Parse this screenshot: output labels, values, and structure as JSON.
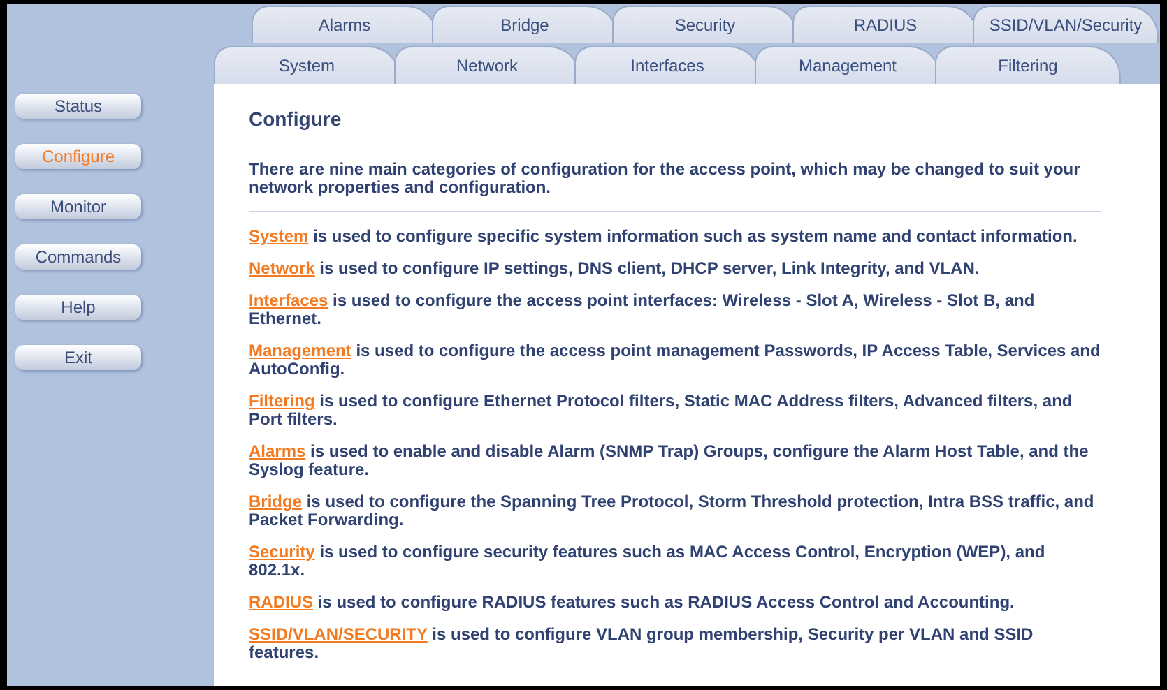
{
  "tabs_row_1": [
    {
      "label": "Alarms"
    },
    {
      "label": "Bridge"
    },
    {
      "label": "Security"
    },
    {
      "label": "RADIUS"
    },
    {
      "label": "SSID/VLAN/Security"
    }
  ],
  "tabs_row_2": [
    {
      "label": "System"
    },
    {
      "label": "Network"
    },
    {
      "label": "Interfaces"
    },
    {
      "label": "Management"
    },
    {
      "label": "Filtering"
    }
  ],
  "sidebar": {
    "items": [
      {
        "label": "Status",
        "selected": false
      },
      {
        "label": "Configure",
        "selected": true
      },
      {
        "label": "Monitor",
        "selected": false
      },
      {
        "label": "Commands",
        "selected": false
      },
      {
        "label": "Help",
        "selected": false
      },
      {
        "label": "Exit",
        "selected": false
      }
    ]
  },
  "content": {
    "title": "Configure",
    "intro": "There are nine main categories of configuration for the access point, which may be changed to suit your network properties and configuration.",
    "categories": [
      {
        "link": "System",
        "text": "is used to configure specific system information such as system name and contact information."
      },
      {
        "link": "Network",
        "text": "is used to configure IP settings, DNS client, DHCP server, Link Integrity, and VLAN."
      },
      {
        "link": "Interfaces",
        "text": "is used to configure the access point interfaces: Wireless - Slot A, Wireless - Slot B, and Ethernet."
      },
      {
        "link": "Management",
        "text": "is used to configure the access point management Passwords, IP Access Table, Services and AutoConfig."
      },
      {
        "link": "Filtering",
        "text": "is used to configure Ethernet Protocol filters, Static MAC Address filters, Advanced filters, and Port filters."
      },
      {
        "link": "Alarms",
        "text": "is used to enable and disable Alarm (SNMP Trap) Groups, configure the Alarm Host Table, and the Syslog feature."
      },
      {
        "link": "Bridge",
        "text": "is used to configure the Spanning Tree Protocol, Storm Threshold protection, Intra BSS traffic, and Packet Forwarding."
      },
      {
        "link": "Security",
        "text": "is used to configure security features such as MAC Access Control, Encryption (WEP), and 802.1x."
      },
      {
        "link": "RADIUS",
        "text": "is used to configure RADIUS features such as RADIUS Access Control and Accounting."
      },
      {
        "link": "SSID/VLAN/SECURITY",
        "text": "is used to configure VLAN group membership, Security per VLAN and SSID features."
      }
    ]
  }
}
